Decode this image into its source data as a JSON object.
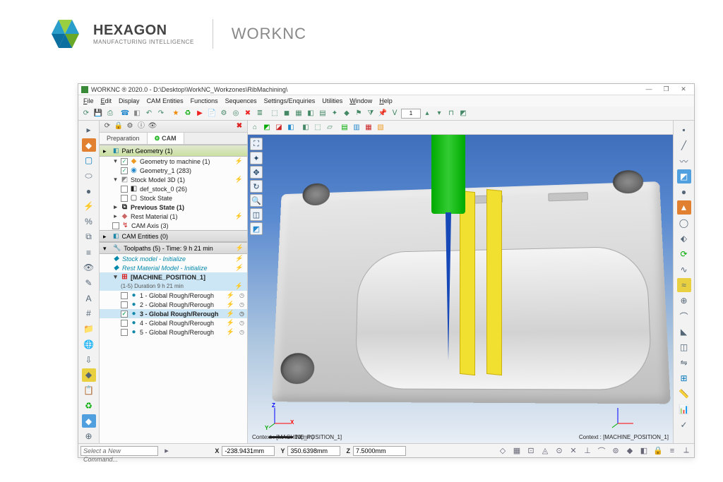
{
  "brand": {
    "name": "HEXAGON",
    "subtitle": "MANUFACTURING INTELLIGENCE",
    "product": "WORKNC"
  },
  "window": {
    "title": "WORKNC ® 2020.0 - D:\\Desktop\\WorkNC_Workzones\\RibMachining\\",
    "minimize": "—",
    "restore": "❐",
    "close": "✕"
  },
  "menu": {
    "file": "File",
    "edit": "Edit",
    "display": "Display",
    "cam_entities": "CAM Entities",
    "functions": "Functions",
    "sequences": "Sequences",
    "settings": "Settings/Enquiries",
    "utilities": "Utilities",
    "window": "Window",
    "help": "Help"
  },
  "toolbar": {
    "spin_value": "1"
  },
  "tree": {
    "tab_preparation": "Preparation",
    "tab_cam": "CAM",
    "section_part": "Part Geometry (1)",
    "geometry_to_machine": "Geometry to machine (1)",
    "geometry_1": "Geometry_1 (283)",
    "stock_model_3d": "Stock Model 3D (1)",
    "def_stock": "def_stock_0 (26)",
    "stock_state": "Stock State",
    "previous_state": "Previous State (1)",
    "rest_material": "Rest Material (1)",
    "cam_axis": "CAM Axis (3)",
    "section_cam_entities": "CAM Entities (0)",
    "section_toolpaths": "Toolpaths (5) - Time: 9 h 21 min",
    "tp_stock_init": "Stock model - Initialize",
    "tp_rest_init": "Rest Material Model - Initialize",
    "tp_machpos": "[MACHINE_POSITION_1]",
    "tp_machpos_sub": "(1-5) Duration 9 h 21 min",
    "tp_1": "1 - Global Rough/Rerough",
    "tp_2": "2 - Global Rough/Rerough",
    "tp_3": "3 - Global Rough/Rerough",
    "tp_4": "4 - Global Rough/Rerough",
    "tp_5": "5 - Global Rough/Rerough"
  },
  "viewport": {
    "context_left": "Context : [MACHINE_POSITION_1]",
    "context_right": "Context : [MACHINE_POSITION_1]",
    "scale_label": "10(mm)",
    "axis_x": "X",
    "axis_y": "Y",
    "axis_z": "Z"
  },
  "status": {
    "command_placeholder": "Select a New Command...",
    "x_label": "X",
    "x_val": "-238.9431mm",
    "y_label": "Y",
    "y_val": "350.6398mm",
    "z_label": "Z",
    "z_val": "7.5000mm"
  }
}
